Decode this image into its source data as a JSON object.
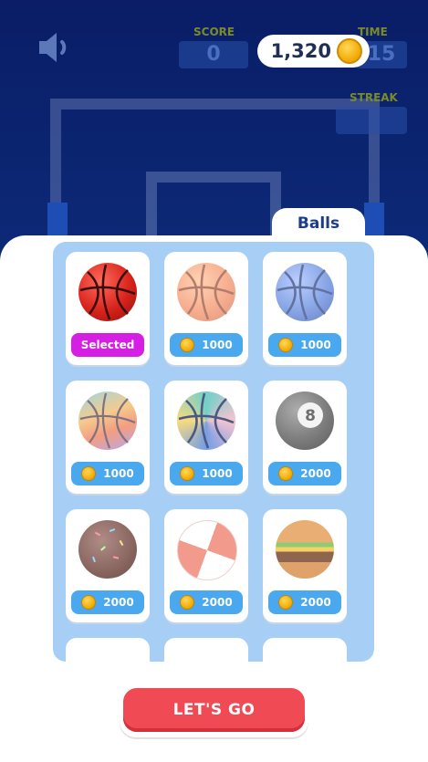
{
  "hud": {
    "score_label": "SCORE",
    "score_value": "0",
    "time_label": "TIME",
    "time_value": "15",
    "streak_label": "STREAK",
    "coins": "1,320"
  },
  "shop": {
    "tab_label": "Balls",
    "items": [
      {
        "name": "basketball-red",
        "label": "Selected",
        "selected": true
      },
      {
        "name": "basketball-orange",
        "label": "1000"
      },
      {
        "name": "basketball-blue",
        "label": "1000"
      },
      {
        "name": "basketball-pastel",
        "label": "1000"
      },
      {
        "name": "basketball-swirl",
        "label": "1000"
      },
      {
        "name": "eight-ball",
        "label": "2000"
      },
      {
        "name": "donut-ball",
        "label": "2000"
      },
      {
        "name": "beach-ball",
        "label": "2000"
      },
      {
        "name": "burger-ball",
        "label": "2000"
      }
    ],
    "go_label": "LET'S GO"
  },
  "colors": {
    "selected": "#d51fe3",
    "price": "#4aa8ee",
    "go": "#f04a55"
  }
}
